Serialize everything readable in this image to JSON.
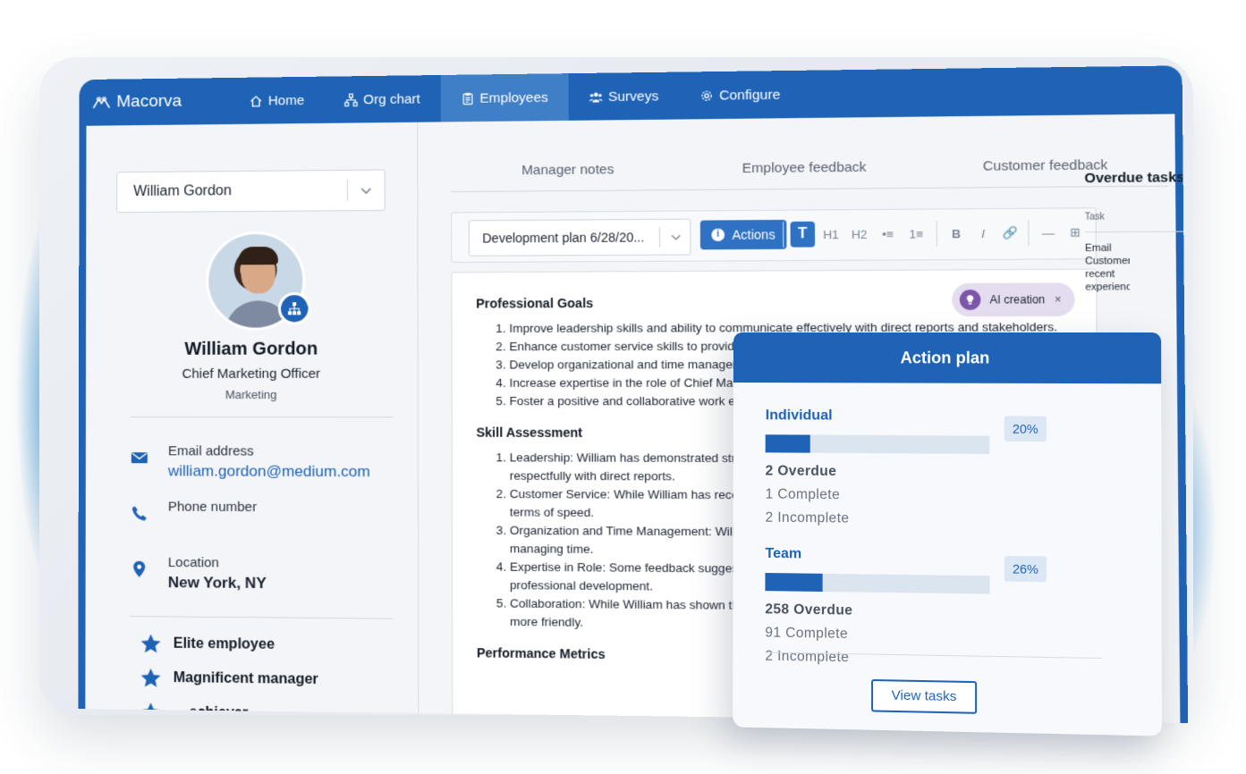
{
  "nav": {
    "brand": "Macorva",
    "items": [
      {
        "label": "Home",
        "icon": "home-icon"
      },
      {
        "label": "Org chart",
        "icon": "org-chart-icon"
      },
      {
        "label": "Employees",
        "icon": "clipboard-icon",
        "active": true
      },
      {
        "label": "Surveys",
        "icon": "people-icon"
      },
      {
        "label": "Configure",
        "icon": "gear-icon"
      }
    ]
  },
  "profile": {
    "selected_employee": "William Gordon",
    "name": "William Gordon",
    "title": "Chief Marketing Officer",
    "department": "Marketing",
    "email_label": "Email address",
    "email": "william.gordon@medium.com",
    "phone_label": "Phone number",
    "location_label": "Location",
    "location": "New York, NY",
    "awards": [
      "Elite employee",
      "Magnificent manager",
      "... achiever"
    ]
  },
  "tabs": [
    "Manager notes",
    "Employee feedback",
    "Customer feedback"
  ],
  "toolbar": {
    "plan_select": "Development plan 6/28/20...",
    "actions_label": "Actions",
    "format_buttons": [
      "T",
      "H1",
      "H2",
      "•≡",
      "1≡",
      "B",
      "I",
      "🔗",
      "—",
      "⊞"
    ]
  },
  "ai_chip": {
    "label": "AI creation",
    "close": "×"
  },
  "document": {
    "goals_heading": "Professional Goals",
    "goals": [
      "Improve leadership skills and ability to communicate effectively with direct reports and stakeholders.",
      "Enhance customer service skills to provide a positive and attentive experience for customers.",
      "Develop organizational and time management skills.",
      "Increase expertise in the role of Chief Marketing Officer to meet marketing objectives.",
      "Foster a positive and collaborative work environment with coworkers."
    ],
    "skills_heading": "Skill Assessment",
    "skills": [
      "Leadership: William has demonstrated strong leadership but could improve in communicating respectfully with direct reports.",
      "Customer Service: While William has received positive feedback, there is room for improvement in terms of speed.",
      "Organization and Time Management: William has shown improvement in organizing tasks and managing time.",
      "Expertise in Role: Some feedback suggests the Chief Marketing Officer, indicating a need for further professional development.",
      "Collaboration: While William has shown the ability, there is room for improvement in terms of being more friendly."
    ],
    "metrics_heading": "Performance Metrics"
  },
  "overdue_panel": {
    "title": "Overdue tasks",
    "column": "Task",
    "cell_text": "Email Customer recent experience"
  },
  "action_plan": {
    "title": "Action plan",
    "groups": [
      {
        "name": "Individual",
        "progress": 0.2,
        "pct_label": "20%",
        "overdue": "2 Overdue",
        "complete": "1 Complete",
        "incomplete": "2 Incomplete"
      },
      {
        "name": "Team",
        "progress": 0.26,
        "pct_label": "26%",
        "overdue": "258 Overdue",
        "complete": "91 Complete",
        "incomplete": "2 Incomplete"
      }
    ],
    "view_button": "View tasks"
  },
  "colors": {
    "brand_blue": "#1f63b6",
    "ai_chip_bg": "#e4dcef"
  }
}
